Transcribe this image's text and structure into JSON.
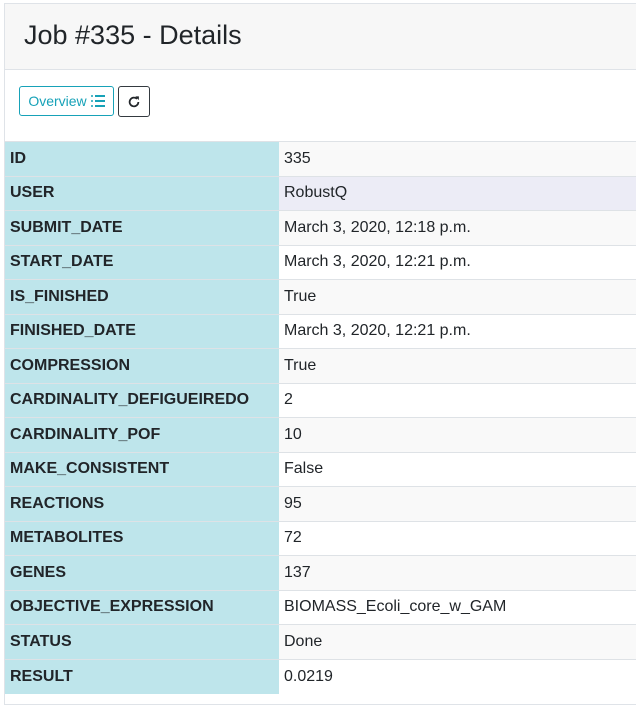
{
  "header": {
    "title": "Job #335 - Details"
  },
  "toolbar": {
    "overview_label": "Overview",
    "overview_icon": "list-icon",
    "refresh_icon": "refresh-icon",
    "accent_color": "#17a2b8"
  },
  "details": {
    "key_background": "#bee5eb",
    "rows": [
      {
        "key": "ID",
        "value": "335"
      },
      {
        "key": "USER",
        "value": "RobustQ"
      },
      {
        "key": "SUBMIT_DATE",
        "value": "March 3, 2020, 12:18 p.m."
      },
      {
        "key": "START_DATE",
        "value": "March 3, 2020, 12:21 p.m."
      },
      {
        "key": "IS_FINISHED",
        "value": "True"
      },
      {
        "key": "FINISHED_DATE",
        "value": "March 3, 2020, 12:21 p.m."
      },
      {
        "key": "COMPRESSION",
        "value": "True"
      },
      {
        "key": "CARDINALITY_DEFIGUEIREDO",
        "value": "2"
      },
      {
        "key": "CARDINALITY_POF",
        "value": "10"
      },
      {
        "key": "MAKE_CONSISTENT",
        "value": "False"
      },
      {
        "key": "REACTIONS",
        "value": "95"
      },
      {
        "key": "METABOLITES",
        "value": "72"
      },
      {
        "key": "GENES",
        "value": "137"
      },
      {
        "key": "OBJECTIVE_EXPRESSION",
        "value": "BIOMASS_Ecoli_core_w_GAM"
      },
      {
        "key": "STATUS",
        "value": "Done"
      },
      {
        "key": "RESULT",
        "value": "0.0219"
      }
    ]
  }
}
